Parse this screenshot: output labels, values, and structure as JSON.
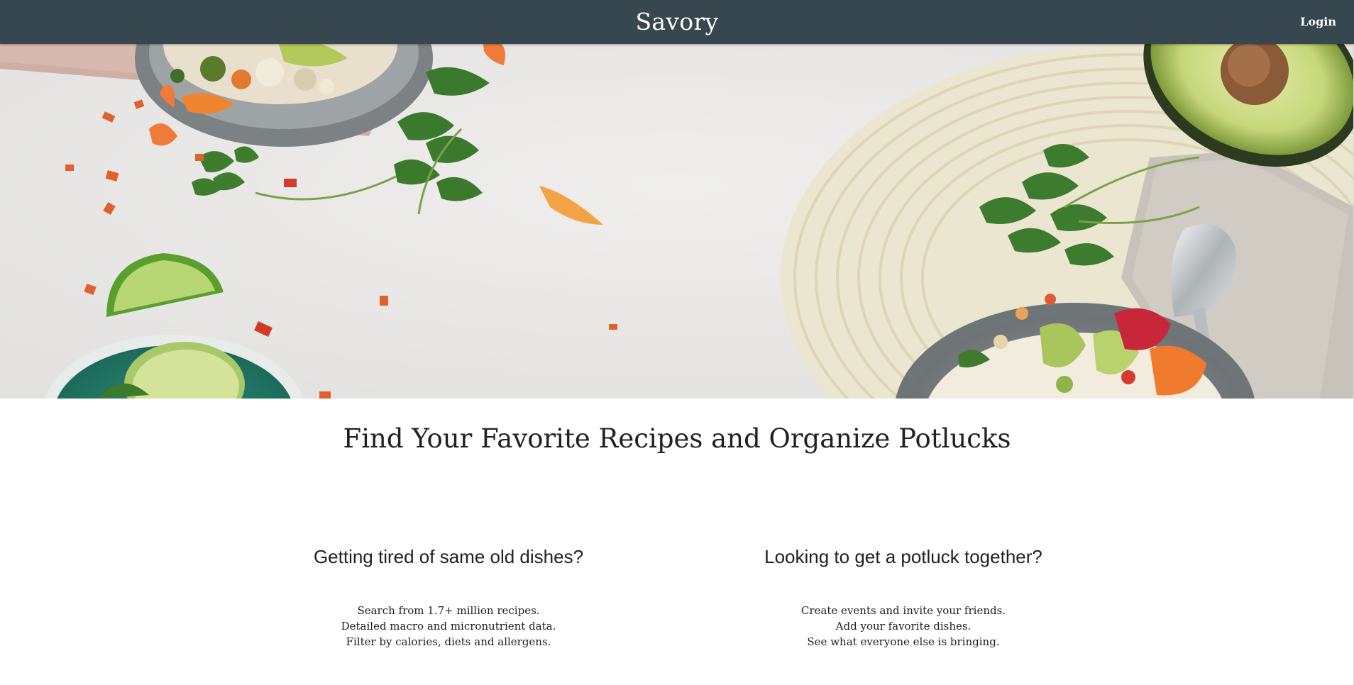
{
  "navbar": {
    "brand": "Savory",
    "login_label": "Login",
    "background_color": "#37474f"
  },
  "hero": {
    "image_subject": "overhead food flatlay: rice bowls, avocado, lime, cilantro, flower petals, woven placemat, spoon on napkin"
  },
  "main": {
    "headline": "Find Your Favorite Recipes and Organize Potlucks",
    "features": [
      {
        "title": "Getting tired of same old dishes?",
        "lines": [
          "Search from 1.7+ million recipes.",
          "Detailed macro and micronutrient data.",
          "Filter by calories, diets and allergens."
        ]
      },
      {
        "title": "Looking to get a potluck together?",
        "lines": [
          "Create events and invite your friends.",
          "Add your favorite dishes.",
          "See what everyone else is bringing."
        ]
      }
    ]
  },
  "icons": {
    "logo": "savory-wordmark"
  }
}
